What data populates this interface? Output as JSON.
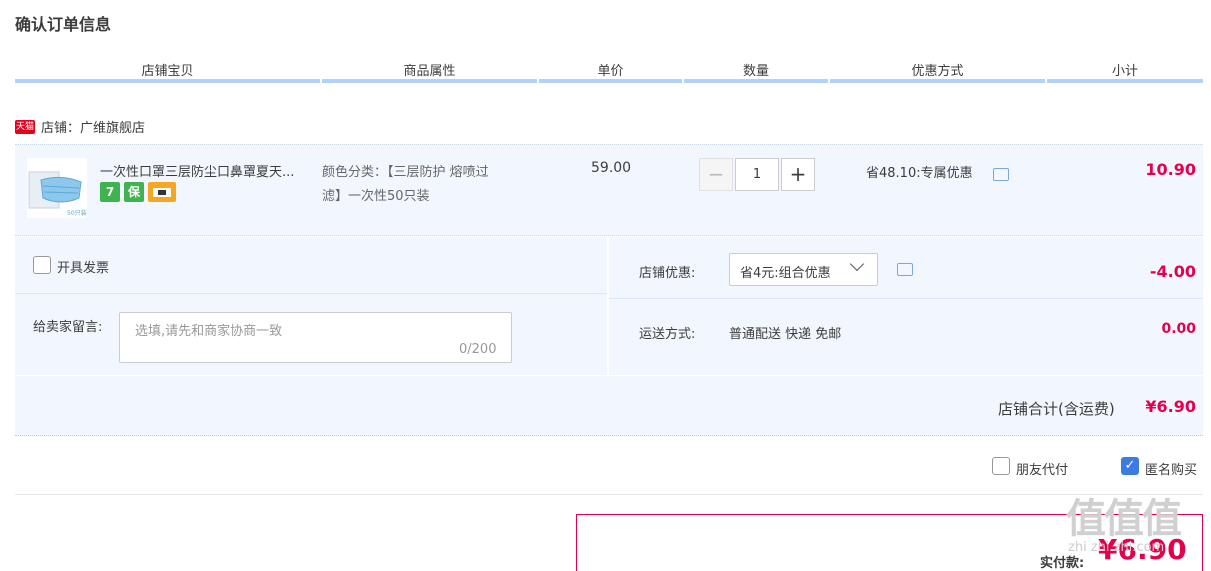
{
  "page": {
    "title": "确认订单信息"
  },
  "columns": [
    "店铺宝贝",
    "商品属性",
    "单价",
    "数量",
    "优惠方式",
    "小计"
  ],
  "shop": {
    "badge": "天猫",
    "label": "店铺：广维旗舰店"
  },
  "item": {
    "title": "一次性口罩三层防尘口鼻罩夏天...",
    "service_icons": [
      "7",
      "保",
      "card"
    ],
    "attr_line1": "颜色分类：【三层防护 熔喷过",
    "attr_line2": "滤】一次性50只装",
    "price": "59.00",
    "quantity": "1",
    "minus": "−",
    "plus": "+",
    "promo": "省48.10:专属优惠",
    "subtotal": "10.90",
    "thumb_label": "50只装"
  },
  "invoice": {
    "label": "开具发票",
    "checked": false
  },
  "message": {
    "label": "给卖家留言:",
    "placeholder": "选填,请先和商家协商一致",
    "counter": "0/200"
  },
  "shop_discount": {
    "label": "店铺优惠:",
    "selected": "省4元:组合优惠",
    "amount": "-4.00"
  },
  "shipping": {
    "label": "运送方式:",
    "value": "普通配送 快递 免邮",
    "amount": "0.00"
  },
  "shop_total": {
    "label": "店铺合计(含运费)",
    "amount": "¥6.90"
  },
  "options": {
    "friend_pay": "朋友代付",
    "friend_pay_checked": false,
    "anonymous": "匿名购买",
    "anonymous_checked": true
  },
  "payment": {
    "label": "实付款:",
    "amount": "¥6.90"
  },
  "watermark": {
    "main": "值值值",
    "sub": "zhi zhi zhi.com"
  },
  "colors": {
    "accent_red": "#e5004f",
    "header_line": "#b2d1ff",
    "row_bg": "#f2f7ff",
    "tmall_red": "#e5001c"
  }
}
